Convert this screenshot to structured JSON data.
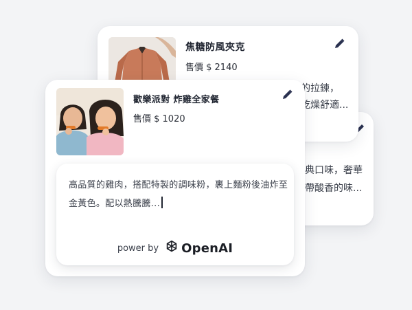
{
  "cards": [
    {
      "name": "焦糖防風夾克",
      "price": "售價 $ 2140",
      "description_fragments": [
        "的拉鍊，",
        "乾燥舒適..."
      ],
      "image": "jacket-photo"
    },
    {
      "description_fragments": [
        "典口味，奢華",
        "帶酸香的味..."
      ]
    },
    {
      "name": "歡樂派對 炸雞全家餐",
      "price": "售價 $ 1020",
      "image": "friends-photo",
      "ai_description": "高品質的雞肉，搭配特製的調味粉，裹上麵粉後油炸至金黃色。配以熱騰騰...",
      "power_by": "power by",
      "brand": "OpenAI"
    }
  ],
  "icons": {
    "edit": "pencil-icon",
    "brand_logo": "openai-logo"
  },
  "colors": {
    "background": "#f3f4f6",
    "card": "#ffffff",
    "text": "#1f2430",
    "icon": "#2a3150"
  }
}
